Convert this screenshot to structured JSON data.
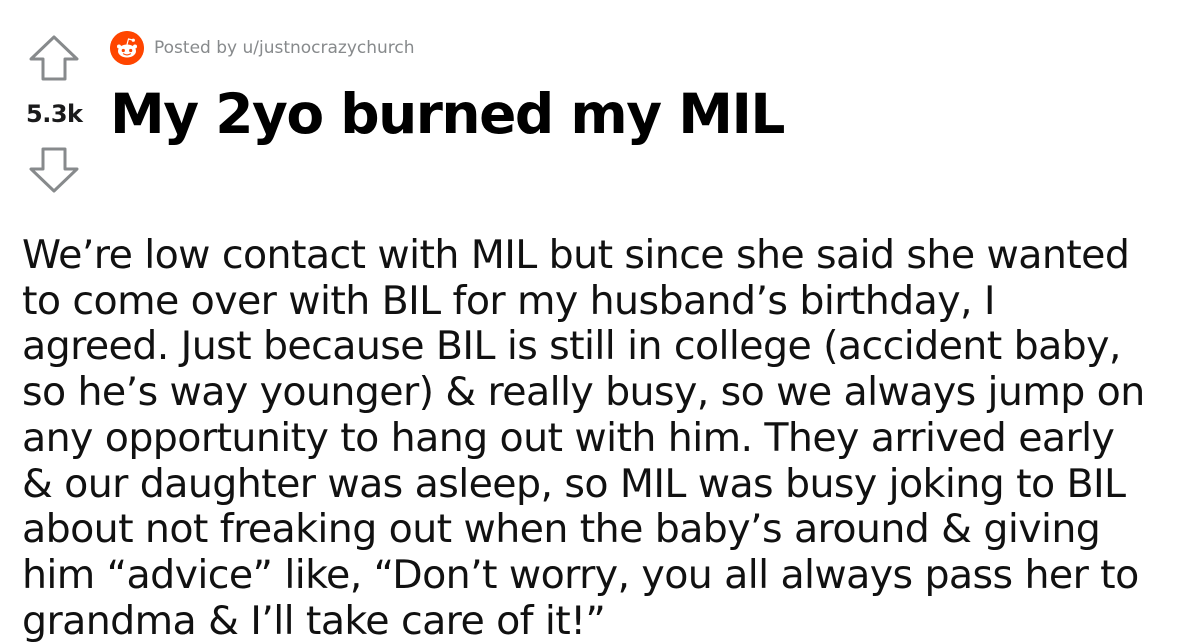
{
  "post": {
    "score": "5.3k",
    "posted_by": "Posted by u/justnocrazychurch",
    "title": "My 2yo burned my MIL",
    "body_lines": [
      "We’re low contact with MIL but since she said she wanted",
      "to come over with BIL for my husband’s birthday, I",
      "agreed. Just because BIL is still in college (accident baby,",
      "so he’s way younger) & really busy, so we always jump on",
      "any opportunity to hang out with him. They arrived early",
      "& our daughter was asleep, so MIL was busy joking to BIL",
      "about not freaking out when the baby’s around & giving",
      "him “advice” like, “Don’t worry, you all always pass her to",
      "grandma & I’ll take care of it!”"
    ]
  },
  "icons": {
    "upvote": "arrow-up-icon",
    "downvote": "arrow-down-icon",
    "avatar": "snoo-avatar-icon"
  },
  "colors": {
    "avatar_bg": "#ff4500",
    "meta_text": "#878a8c",
    "arrow_stroke": "#878a8c",
    "title_text": "#000000",
    "body_text": "#111111"
  }
}
